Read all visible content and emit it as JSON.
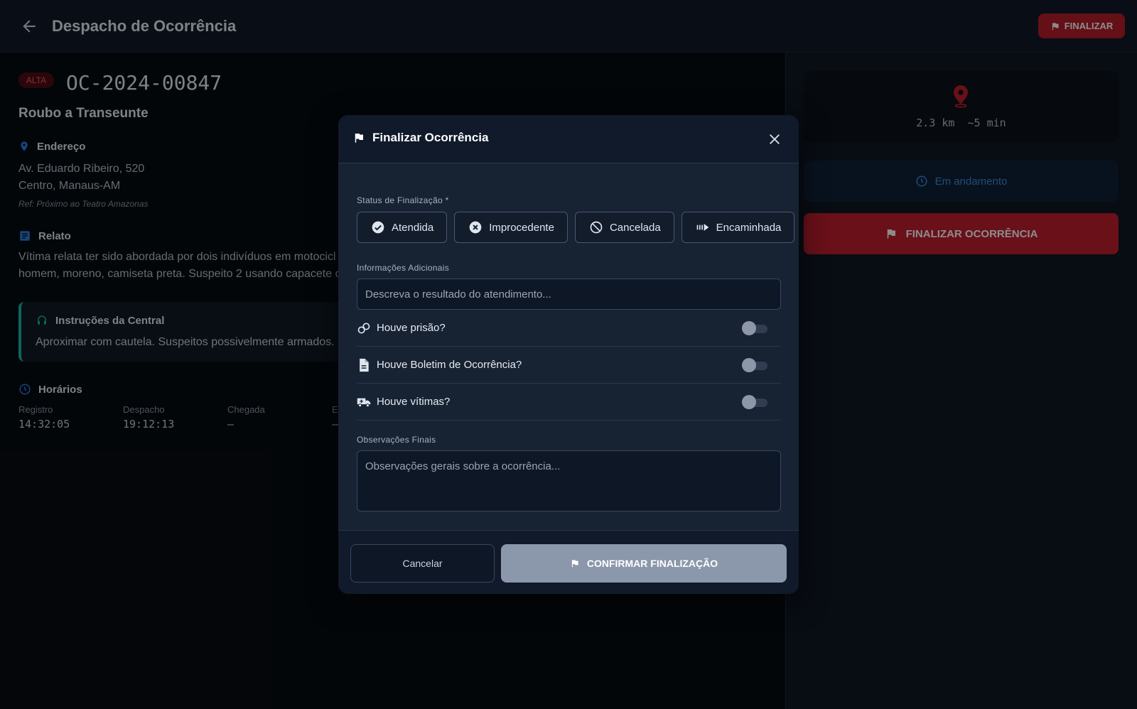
{
  "header": {
    "title": "Despacho de Ocorrência",
    "finalize_label": "FINALIZAR"
  },
  "occurrence": {
    "priority": "ALTA",
    "id": "OC-2024-00847",
    "type": "Roubo a Transeunte",
    "address": {
      "heading": "Endereço",
      "line1": "Av. Eduardo Ribeiro, 520",
      "line2": "Centro, Manaus-AM",
      "reference": "Ref: Próximo ao Teatro Amazonas"
    },
    "report": {
      "heading": "Relato",
      "line1": "Vítima relata ter sido abordada por dois indivíduos em motocicl",
      "line2": "homem, moreno, camiseta preta. Suspeito 2 usando capacete c"
    },
    "instructions": {
      "heading": "Instruções da Central",
      "text": "Aproximar com cautela. Suspeitos possivelmente armados."
    },
    "times": {
      "heading": "Horários",
      "items": [
        {
          "label": "Registro",
          "value": "14:32:05"
        },
        {
          "label": "Despacho",
          "value": "19:12:13"
        },
        {
          "label": "Chegada",
          "value": "–"
        },
        {
          "label": "E",
          "value": "–"
        }
      ]
    }
  },
  "side": {
    "distance": "2.3 km  ~5 min",
    "status": "Em andamento",
    "finalize_big": "FINALIZAR OCORRÊNCIA"
  },
  "modal": {
    "title": "Finalizar Ocorrência",
    "status_label": "Status de Finalização *",
    "status_options": [
      {
        "label": "Atendida",
        "icon": "check-circle-icon"
      },
      {
        "label": "Improcedente",
        "icon": "x-circle-icon"
      },
      {
        "label": "Cancelada",
        "icon": "ban-icon"
      },
      {
        "label": "Encaminhada",
        "icon": "forward-icon"
      }
    ],
    "info_label": "Informações Adicionais",
    "info_placeholder": "Descreva o resultado do atendimento...",
    "toggles": [
      {
        "label": "Houve prisão?",
        "icon": "handcuffs-icon",
        "on": false
      },
      {
        "label": "Houve Boletim de Ocorrência?",
        "icon": "document-icon",
        "on": false
      },
      {
        "label": "Houve vítimas?",
        "icon": "ambulance-icon",
        "on": false
      }
    ],
    "notes_label": "Observações Finais",
    "notes_placeholder": "Observações gerais sobre a ocorrência...",
    "cancel_label": "Cancelar",
    "confirm_label": "CONFIRMAR FINALIZAÇÃO"
  },
  "colors": {
    "accent_red": "#c01e2e",
    "teal": "#18b6a6",
    "status_blue": "#3f8ad8"
  }
}
